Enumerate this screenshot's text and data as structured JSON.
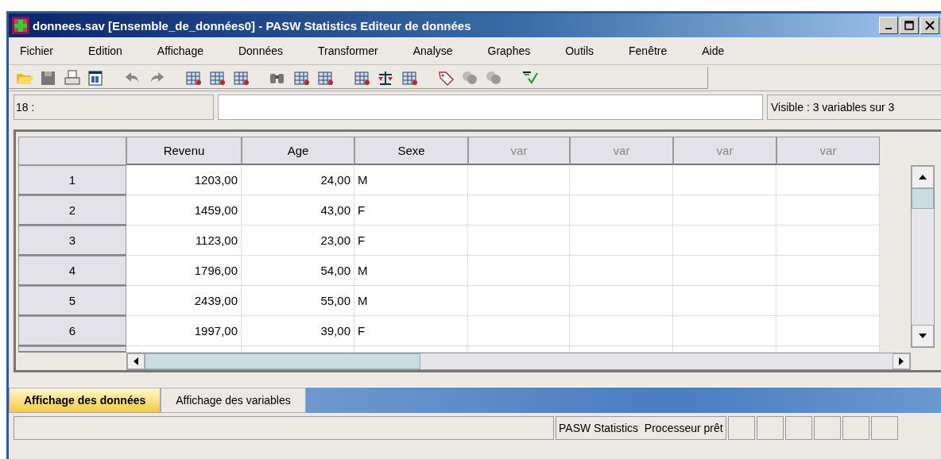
{
  "window": {
    "title": "donnees.sav [Ensemble_de_données0] - PASW Statistics Editeur de données"
  },
  "menu": [
    "Fichier",
    "Edition",
    "Affichage",
    "Données",
    "Transformer",
    "Analyse",
    "Graphes",
    "Outils",
    "Fenêtre",
    "Aide"
  ],
  "cell_editor": {
    "cell": "18 :",
    "visible": "Visible : 3 variables sur 3"
  },
  "table": {
    "columns": [
      {
        "label": "Revenu",
        "defined": true
      },
      {
        "label": "Age",
        "defined": true
      },
      {
        "label": "Sexe",
        "defined": true
      },
      {
        "label": "var",
        "defined": false
      },
      {
        "label": "var",
        "defined": false
      },
      {
        "label": "var",
        "defined": false
      },
      {
        "label": "var",
        "defined": false
      }
    ],
    "rows": [
      {
        "number": "1",
        "cells": [
          "1203,00",
          "24,00",
          "M"
        ]
      },
      {
        "number": "2",
        "cells": [
          "1459,00",
          "43,00",
          "F"
        ]
      },
      {
        "number": "3",
        "cells": [
          "1123,00",
          "23,00",
          "F"
        ]
      },
      {
        "number": "4",
        "cells": [
          "1796,00",
          "54,00",
          "M"
        ]
      },
      {
        "number": "5",
        "cells": [
          "2439,00",
          "55,00",
          "M"
        ]
      },
      {
        "number": "6",
        "cells": [
          "1997,00",
          "39,00",
          "F"
        ]
      }
    ]
  },
  "tabs": [
    {
      "label": "Affichage des données",
      "selected": true
    },
    {
      "label": "Affichage des variables",
      "selected": false
    }
  ],
  "status_bar": {
    "text": "PASW Statistics  Processeur prêt"
  }
}
